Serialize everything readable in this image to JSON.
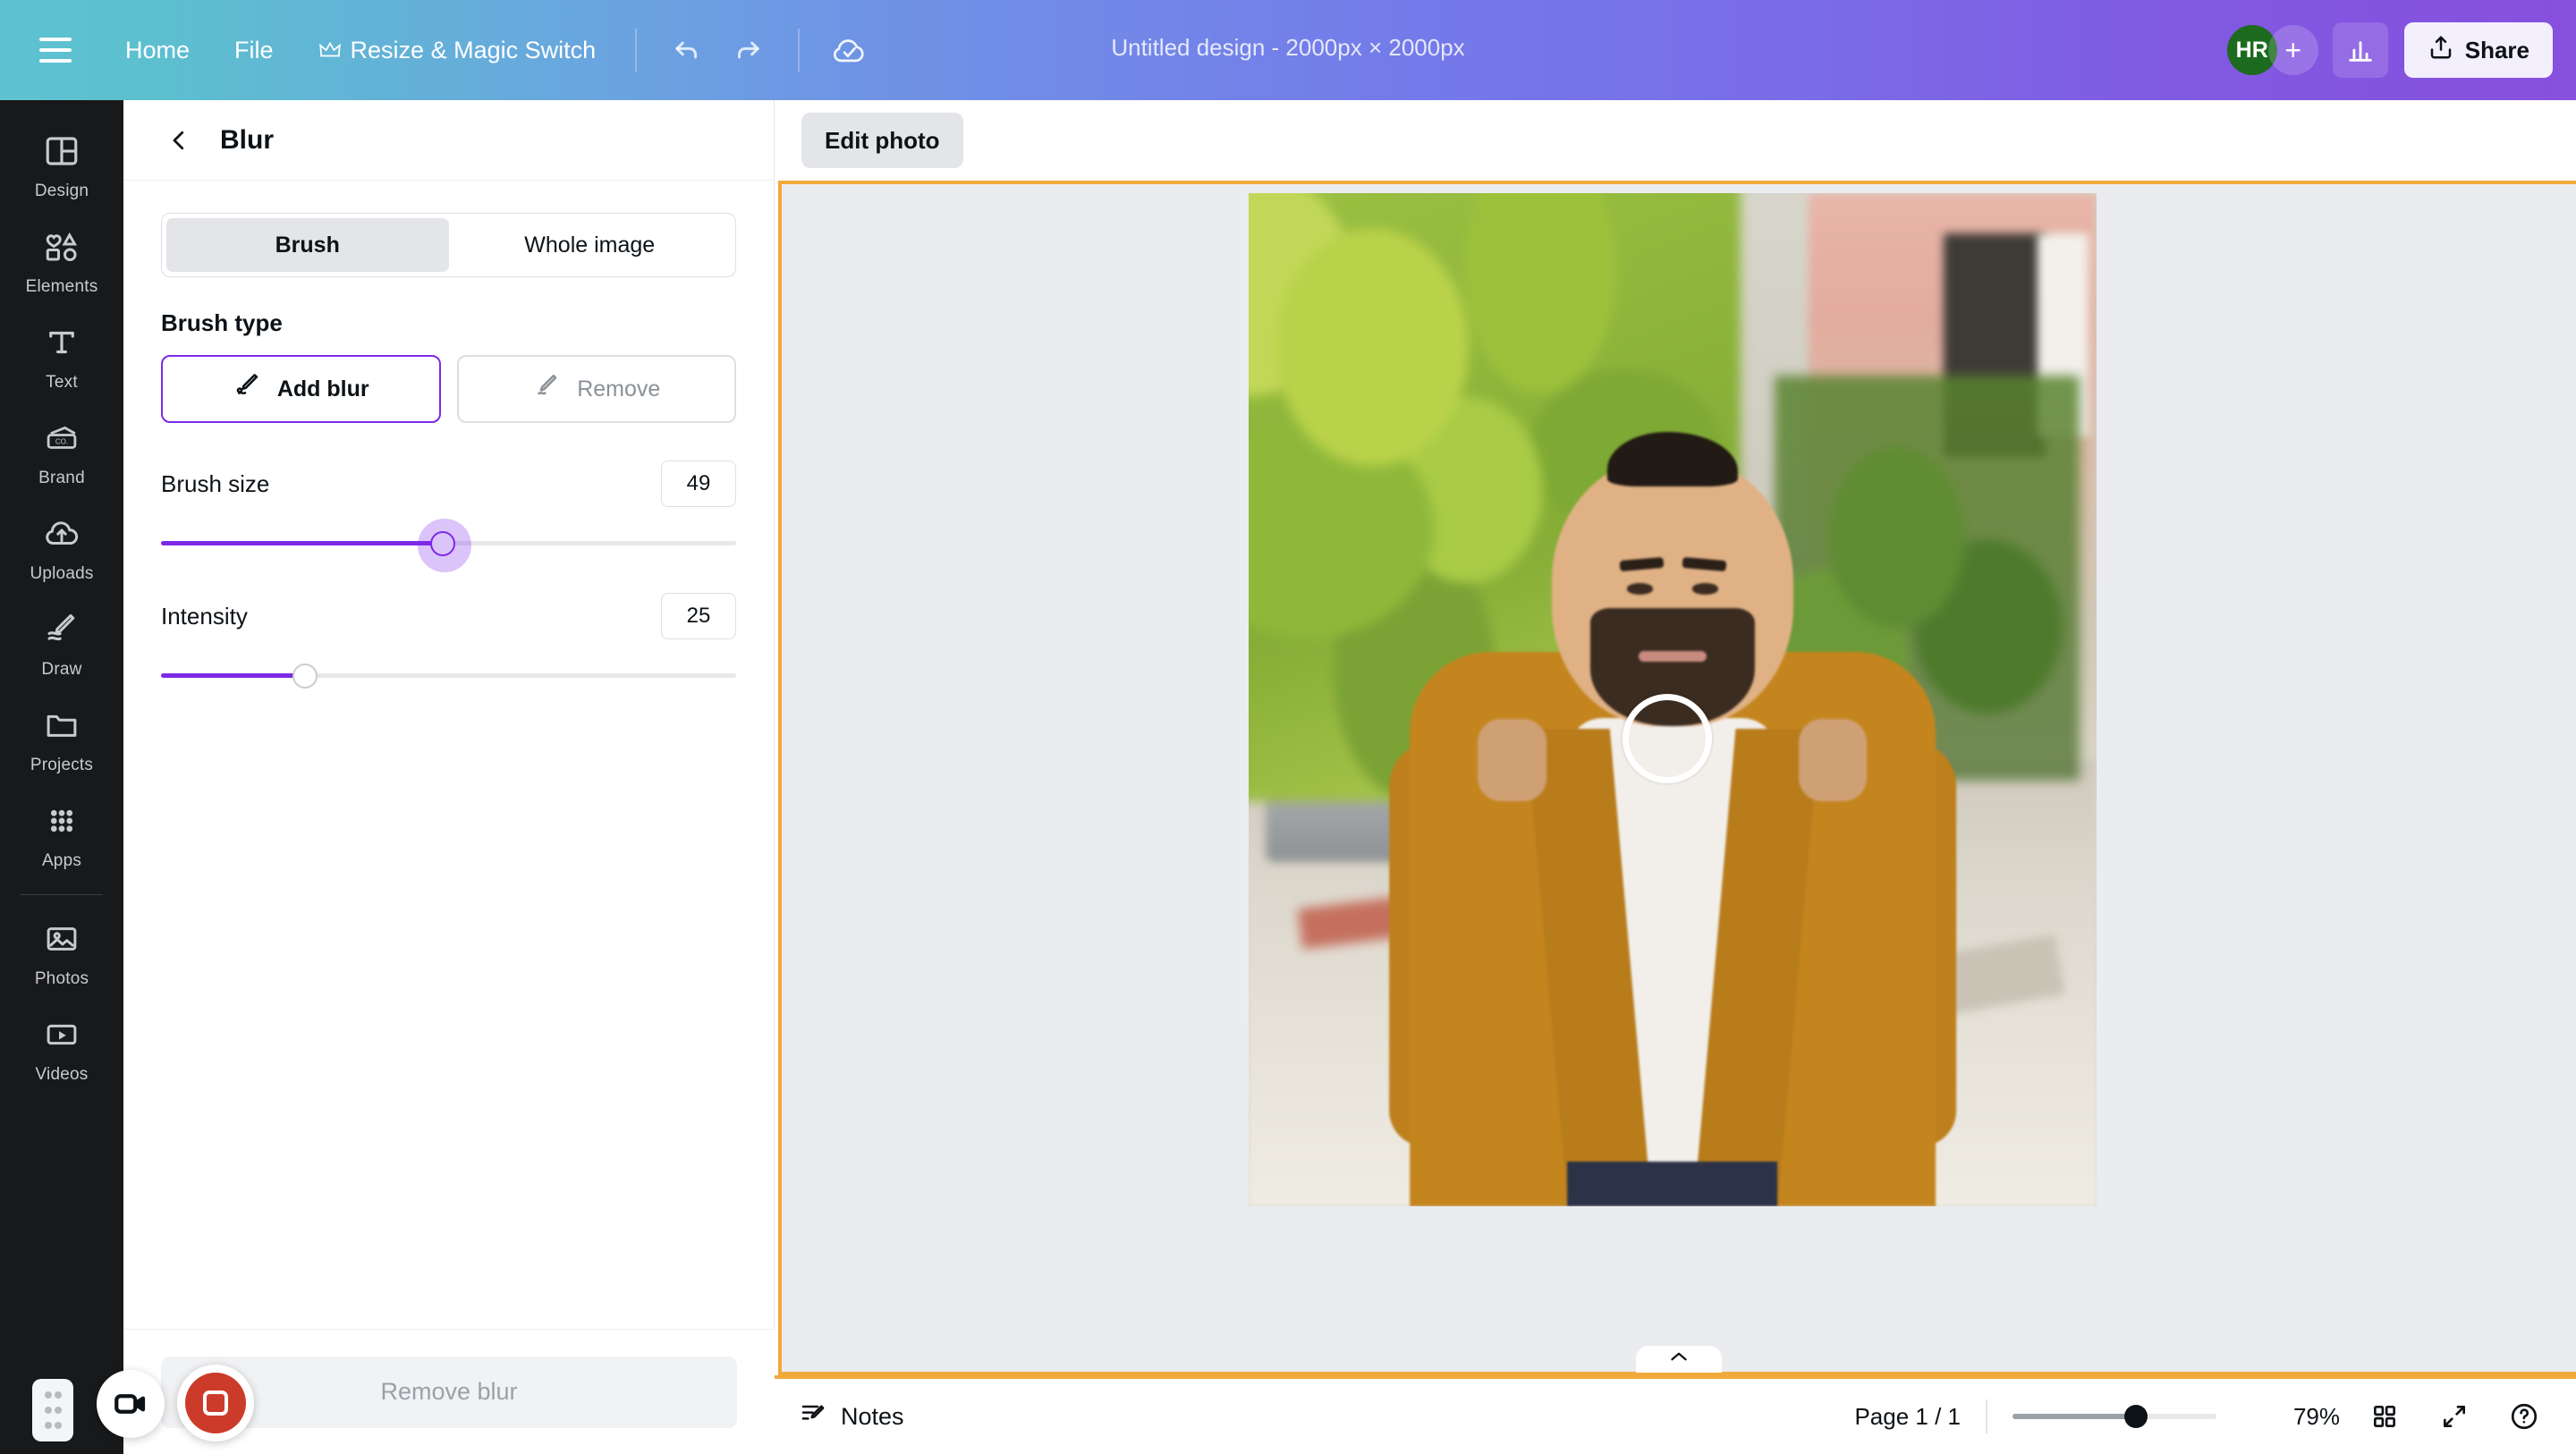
{
  "topbar": {
    "menu_icon": "hamburger-icon",
    "nav": [
      {
        "label": "Home",
        "icon": null
      },
      {
        "label": "File",
        "icon": null
      },
      {
        "label": "Resize & Magic Switch",
        "icon": "crown-icon"
      }
    ],
    "undo_icon": "undo-icon",
    "redo_icon": "redo-icon",
    "cloud_icon": "cloud-saved-icon",
    "doc_title": "Untitled design - 2000px × 2000px",
    "avatar_initials": "HR",
    "avatar_color": "#1c6b1f",
    "add_collaborator": "+",
    "insights_icon": "bar-chart-icon",
    "share_label": "Share",
    "share_icon": "share-upload-icon"
  },
  "sidebar": {
    "items": [
      {
        "label": "Design",
        "icon": "layout-icon"
      },
      {
        "label": "Elements",
        "icon": "shapes-icon"
      },
      {
        "label": "Text",
        "icon": "text-t-icon"
      },
      {
        "label": "Brand",
        "icon": "brand-card-icon"
      },
      {
        "label": "Uploads",
        "icon": "cloud-upload-icon"
      },
      {
        "label": "Draw",
        "icon": "pen-draw-icon"
      },
      {
        "label": "Projects",
        "icon": "folder-icon"
      },
      {
        "label": "Apps",
        "icon": "grid-dots-icon"
      }
    ],
    "items_after_divider": [
      {
        "label": "Photos",
        "icon": "image-icon"
      },
      {
        "label": "Videos",
        "icon": "video-play-icon"
      }
    ]
  },
  "panel": {
    "back_icon": "chevron-left-icon",
    "title": "Blur",
    "mode_tabs": [
      {
        "label": "Brush",
        "active": true
      },
      {
        "label": "Whole image",
        "active": false
      }
    ],
    "brush_type_label": "Brush type",
    "brush_types": [
      {
        "label": "Add blur",
        "icon": "pen-blur-icon",
        "selected": true
      },
      {
        "label": "Remove",
        "icon": "eraser-icon",
        "selected": false
      }
    ],
    "sliders": [
      {
        "label": "Brush size",
        "value": "49",
        "percent": 49
      },
      {
        "label": "Intensity",
        "value": "25",
        "percent": 25
      }
    ],
    "footer_button": "Remove blur",
    "accent_color": "#7d2ae8"
  },
  "editor": {
    "edit_photo_label": "Edit photo",
    "canvas_border_color": "#f1a93c",
    "canvas_bg": "#eaecef",
    "collapse_icon": "chevron-up-icon",
    "brush_cursor": "brush-circle-cursor"
  },
  "bottombar": {
    "notes_label": "Notes",
    "notes_icon": "notes-pencil-icon",
    "page_count": "Page 1 / 1",
    "zoom_percent": "79%",
    "zoom_value": 79,
    "grid_icon": "grid-view-icon",
    "fullscreen_icon": "expand-arrows-icon",
    "help_icon": "help-circle-icon"
  },
  "recorder": {
    "grip_icon": "drag-grip-icon",
    "camera_icon": "video-camera-icon",
    "stop_icon": "stop-record-icon",
    "stop_color": "#cc3b2a"
  }
}
